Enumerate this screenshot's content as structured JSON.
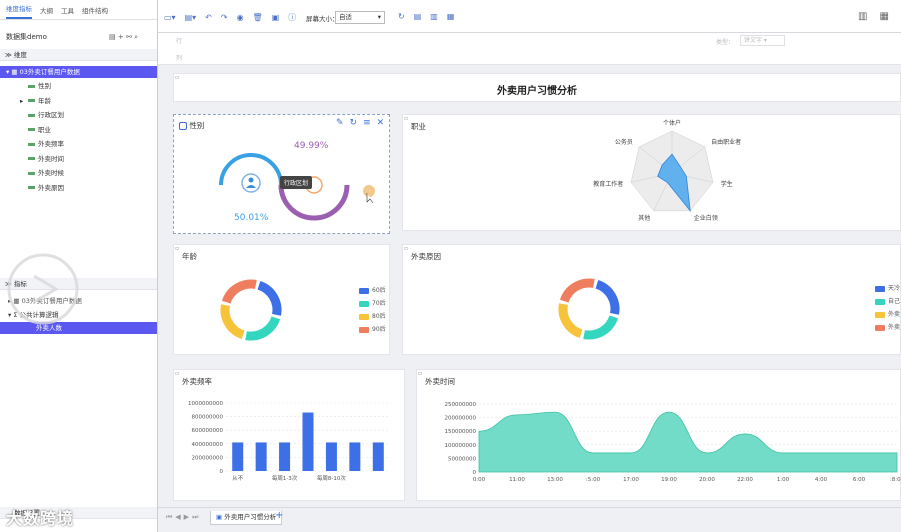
{
  "left": {
    "tabs": [
      "维度指标",
      "大纲",
      "工具",
      "组件结构"
    ],
    "dataset_label": "数据集demo",
    "dim_section": "维度",
    "table_name": "03外卖订餐用户数据",
    "fields": [
      "性别",
      "年龄",
      "行政区划",
      "职业",
      "外卖频率",
      "外卖时间",
      "外卖时候",
      "外卖原因"
    ],
    "measure_section": "指标",
    "measure_table": "03外卖订餐用户数据",
    "measure_group": "公共计算逻辑",
    "measure_selected": "外卖人数",
    "bottom_label": "数据设置"
  },
  "toolbar": {
    "screen_size_label": "屏幕大小：",
    "screen_size_value": "自适"
  },
  "filter": {
    "label1": "行",
    "label2": "列",
    "type_label": "类型：",
    "type_value": "饼文字"
  },
  "report": {
    "title": "外卖用户习惯分析"
  },
  "gender_card": {
    "title": "性别",
    "pct_female": "49.99%",
    "pct_male": "50.01%",
    "tooltip": "行政区划",
    "colors": {
      "male": "#3aa0e4",
      "female": "#9a5fb0"
    }
  },
  "job_card": {
    "title": "职业",
    "chart_data": {
      "type": "radar",
      "axes": [
        "个体户",
        "自由职业者",
        "学生",
        "企业白领",
        "其他",
        "教育工作者",
        "公务员"
      ],
      "values": [
        0.45,
        0.25,
        0.35,
        1.0,
        0.25,
        0.35,
        0.3
      ]
    }
  },
  "age_card": {
    "title": "年龄",
    "chart_data": {
      "type": "pie",
      "categories": [
        "60后",
        "70后",
        "80后",
        "90后"
      ],
      "values": [
        25,
        25,
        25,
        25
      ],
      "colors": [
        "#3d6fe6",
        "#35d6c0",
        "#f7c33a",
        "#ee7e5d"
      ]
    }
  },
  "reason_card": {
    "title": "外卖原因",
    "chart_data": {
      "type": "pie",
      "categories": [
        "天冷",
        "自己",
        "外卖",
        "外卖"
      ],
      "values": [
        25,
        25,
        25,
        25
      ],
      "colors": [
        "#3d6fe6",
        "#35d6c0",
        "#f7c33a",
        "#ee7e5d"
      ]
    }
  },
  "freq_card": {
    "title": "外卖频率",
    "chart_data": {
      "type": "bar",
      "categories": [
        "从不",
        "",
        "每周1-3次",
        "",
        "每周8-10次",
        "",
        ""
      ],
      "values": [
        420000000,
        420000000,
        420000000,
        860000000,
        420000000,
        420000000,
        420000000
      ],
      "yticks": [
        "1000000000",
        "800000000",
        "600000000",
        "400000000",
        "200000000",
        "0"
      ],
      "ylim": [
        0,
        1000000000
      ],
      "color": "#3d6fe6"
    }
  },
  "time_card": {
    "title": "外卖时间",
    "chart_data": {
      "type": "area",
      "x": [
        "0:00",
        "11:00",
        "13:00",
        ":5:00",
        "17:00",
        "19:00",
        "20:00",
        "22:00",
        "1:00",
        "4:00",
        "6:00",
        ":8:00"
      ],
      "values": [
        150000000,
        210000000,
        220000000,
        70000000,
        70000000,
        220000000,
        70000000,
        140000000,
        70000000,
        70000000,
        70000000,
        70000000
      ],
      "yticks": [
        "250000000",
        "200000000",
        "150000000",
        "100000000",
        "50000000",
        "0"
      ],
      "ylim": [
        0,
        250000000
      ],
      "color": "#5ad6be"
    }
  },
  "bottom": {
    "sheet_tab": "外卖用户习惯分析",
    "watermark": "大数跨境"
  }
}
